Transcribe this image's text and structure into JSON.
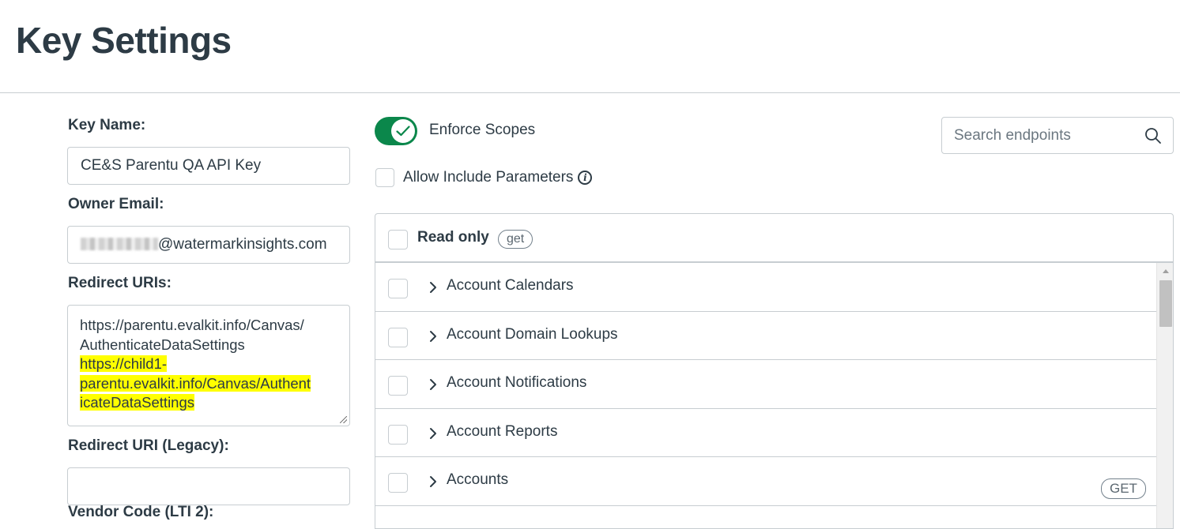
{
  "page": {
    "title": "Key Settings"
  },
  "form": {
    "key_name_label": "Key Name:",
    "key_name_value": "CE&S Parentu QA API Key",
    "owner_email_label": "Owner Email:",
    "owner_email_domain": "@watermarkinsights.com",
    "redirect_uris_label": "Redirect URIs:",
    "redirect_uris": {
      "line1": "https://parentu.evalkit.info/Canvas/",
      "line2": "AuthenticateDataSettings",
      "hl1": "https://child1-",
      "hl2": "parentu.evalkit.info/Canvas/Authent",
      "hl3": "icateDataSettings"
    },
    "redirect_uri_legacy_label": "Redirect URI (Legacy):",
    "redirect_uri_legacy_value": "",
    "vendor_code_label": "Vendor Code (LTI 2):"
  },
  "scopes": {
    "enforce_label": "Enforce Scopes",
    "enforce_on": true,
    "allow_include_label": "Allow Include Parameters",
    "search_placeholder": "Search endpoints",
    "read_only_label": "Read only",
    "read_only_badge": "get",
    "groups": [
      {
        "label": "Account Calendars",
        "badge": ""
      },
      {
        "label": "Account Domain Lookups",
        "badge": ""
      },
      {
        "label": "Account Notifications",
        "badge": ""
      },
      {
        "label": "Account Reports",
        "badge": ""
      },
      {
        "label": "Accounts",
        "badge": "GET"
      }
    ]
  },
  "colors": {
    "toggle_on": "#0b874b",
    "text": "#2d3b45",
    "border": "#c7cdd1",
    "highlight": "#ffff00"
  }
}
